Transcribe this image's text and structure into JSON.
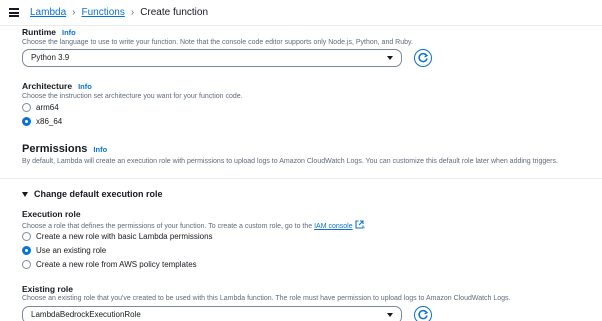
{
  "breadcrumb": {
    "lambda": "Lambda",
    "functions": "Functions",
    "current": "Create function"
  },
  "runtime": {
    "label": "Runtime",
    "info": "Info",
    "description": "Choose the language to use to write your function. Note that the console code editor supports only Node.js, Python, and Ruby.",
    "selected": "Python 3.9"
  },
  "architecture": {
    "label": "Architecture",
    "info": "Info",
    "description": "Choose the instruction set architecture you want for your function code.",
    "options": [
      {
        "label": "arm64",
        "checked": false
      },
      {
        "label": "x86_64",
        "checked": true
      }
    ]
  },
  "permissions": {
    "title": "Permissions",
    "info": "Info",
    "description": "By default, Lambda will create an execution role with permissions to upload logs to Amazon CloudWatch Logs. You can customize this default role later when adding triggers."
  },
  "execution_role_section": {
    "expander": "Change default execution role"
  },
  "execution_role": {
    "label": "Execution role",
    "description": "Choose a role that defines the permissions of your function. To create a custom role, go to the",
    "link": "IAM console",
    "options": [
      {
        "label": "Create a new role with basic Lambda permissions",
        "checked": false
      },
      {
        "label": "Use an existing role",
        "checked": true
      },
      {
        "label": "Create a new role from AWS policy templates",
        "checked": false
      }
    ]
  },
  "existing_role": {
    "label": "Existing role",
    "description": "Choose an existing role that you've created to be used with this Lambda function. The role must have permission to upload logs to Amazon CloudWatch Logs.",
    "selected": "LambdaBedrockExecutionRole"
  },
  "colors": {
    "link": "#0972d3",
    "text": "#16191f",
    "muted": "#5f6b7a"
  }
}
